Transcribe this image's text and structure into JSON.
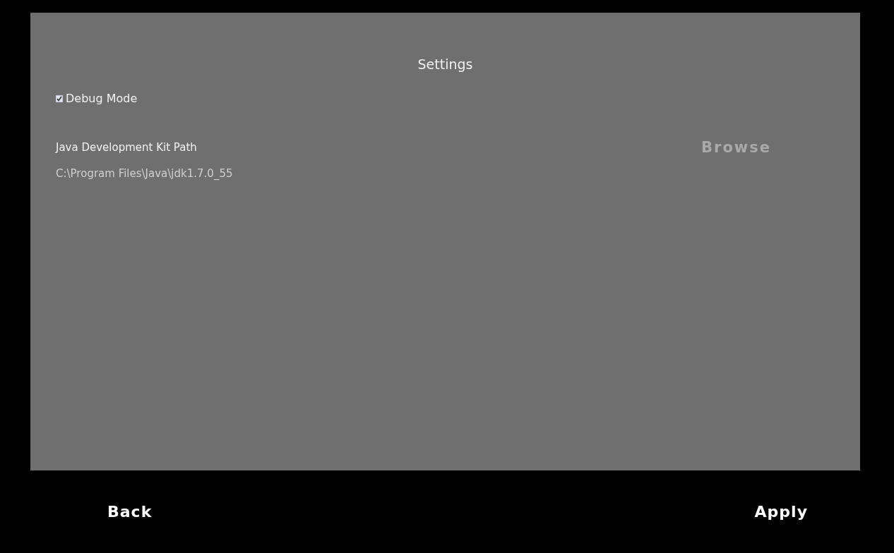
{
  "title": "Settings",
  "debug_mode": {
    "label": "Debug Mode",
    "checked": true
  },
  "jdk_path": {
    "label": "Java Development Kit Path",
    "value": "C:\\Program Files\\Java\\jdk1.7.0_55",
    "browse_button": "Browse"
  },
  "footer": {
    "back_button": "Back",
    "apply_button": "Apply"
  }
}
